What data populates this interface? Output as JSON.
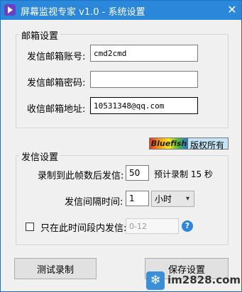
{
  "titlebar": {
    "title": "屏幕监视专家 v1.0 - 系统设置",
    "close_glyph": "✕"
  },
  "email_settings": {
    "group_title": "邮箱设置",
    "sender_account_label": "发信邮箱账号:",
    "sender_account_value": "cmd2cmd",
    "sender_password_label": "发信邮箱密码:",
    "sender_password_value": "",
    "receiver_address_label": "收信邮箱地址:",
    "receiver_address_value": "10531348@qq.com"
  },
  "copyright_badge": {
    "brand": "Bluefish",
    "text": "版权所有"
  },
  "send_settings": {
    "group_title": "发信设置",
    "frames_label": "录制到此帧数后发信:",
    "frames_value": "50",
    "estimate_text": "预计录制 15 秒",
    "interval_label": "发信间隔时间:",
    "interval_value": "1",
    "interval_unit": "小时",
    "only_period_label": "只在此时间段内发信:",
    "only_period_checked": false,
    "period_value": "0-12",
    "help_glyph": "?"
  },
  "buttons": {
    "test_record": "测试录制",
    "save_settings": "保存设置"
  },
  "watermark": {
    "text": "im2828.com"
  }
}
